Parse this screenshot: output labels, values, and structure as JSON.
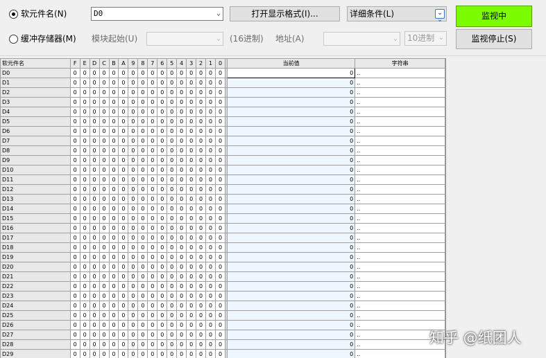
{
  "toolbar": {
    "radio_device": "软元件名(N)",
    "device_input": "D0",
    "open_format_button": "打开显示格式(I)...",
    "detail_select": "详细条件(L)",
    "monitor_start_button": "监视中",
    "radio_buffer": "缓冲存储器(M)",
    "module_start_label": "模块起始(U)",
    "hex_label": "(16进制)",
    "address_label": "地址(A)",
    "radix_select": "10进制",
    "monitor_stop_button": "监视停止(S)"
  },
  "colors": {
    "monitor_active": "#7cfc00",
    "value_cell_bg": "#eef6ff"
  },
  "icons": [
    "chevron-down-icon",
    "expand-double-chevron-icon"
  ],
  "table": {
    "header_device": "软元件名",
    "bit_headers": [
      "F",
      "E",
      "D",
      "C",
      "B",
      "A",
      "9",
      "8",
      "7",
      "6",
      "5",
      "4",
      "3",
      "2",
      "1",
      "0"
    ],
    "header_current": "当前值",
    "header_string": "字符串",
    "rows": [
      {
        "device": "D0",
        "value": "0",
        "string": ".."
      },
      {
        "device": "D1",
        "value": "0",
        "string": ".."
      },
      {
        "device": "D2",
        "value": "0",
        "string": ".."
      },
      {
        "device": "D3",
        "value": "0",
        "string": ".."
      },
      {
        "device": "D4",
        "value": "0",
        "string": ".."
      },
      {
        "device": "D5",
        "value": "0",
        "string": ".."
      },
      {
        "device": "D6",
        "value": "0",
        "string": ".."
      },
      {
        "device": "D7",
        "value": "0",
        "string": ".."
      },
      {
        "device": "D8",
        "value": "0",
        "string": ".."
      },
      {
        "device": "D9",
        "value": "0",
        "string": ".."
      },
      {
        "device": "D10",
        "value": "0",
        "string": ".."
      },
      {
        "device": "D11",
        "value": "0",
        "string": ".."
      },
      {
        "device": "D12",
        "value": "0",
        "string": ".."
      },
      {
        "device": "D13",
        "value": "0",
        "string": ".."
      },
      {
        "device": "D14",
        "value": "0",
        "string": ".."
      },
      {
        "device": "D15",
        "value": "0",
        "string": ".."
      },
      {
        "device": "D16",
        "value": "0",
        "string": ".."
      },
      {
        "device": "D17",
        "value": "0",
        "string": ".."
      },
      {
        "device": "D18",
        "value": "0",
        "string": ".."
      },
      {
        "device": "D19",
        "value": "0",
        "string": ".."
      },
      {
        "device": "D20",
        "value": "0",
        "string": ".."
      },
      {
        "device": "D21",
        "value": "0",
        "string": ".."
      },
      {
        "device": "D22",
        "value": "0",
        "string": ".."
      },
      {
        "device": "D23",
        "value": "0",
        "string": ".."
      },
      {
        "device": "D24",
        "value": "0",
        "string": ".."
      },
      {
        "device": "D25",
        "value": "0",
        "string": ".."
      },
      {
        "device": "D26",
        "value": "0",
        "string": ".."
      },
      {
        "device": "D27",
        "value": "0",
        "string": ".."
      },
      {
        "device": "D28",
        "value": "0",
        "string": ".."
      },
      {
        "device": "D29",
        "value": "0",
        "string": ".."
      }
    ],
    "bit_value": "0"
  },
  "watermark": "知乎 @纸团人"
}
